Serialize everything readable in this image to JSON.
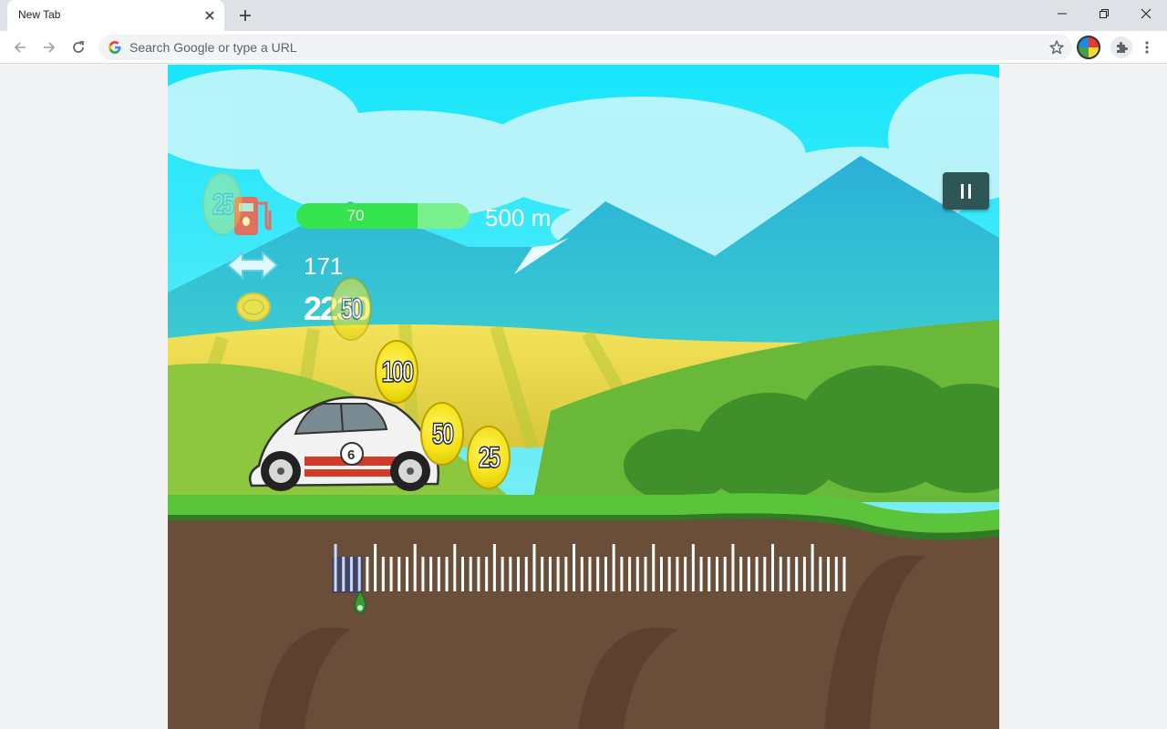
{
  "browser": {
    "tab_title": "New Tab",
    "omnibox_placeholder": "Search Google or type a URL"
  },
  "hud": {
    "fuel_value": "70",
    "fuel_fraction": 0.7,
    "distance_goal": "500 m",
    "distance_value": "171",
    "coins_value": "2230"
  },
  "coins": [
    {
      "value": "100"
    },
    {
      "value": "50"
    },
    {
      "value": "25"
    },
    {
      "value": "50"
    },
    {
      "value": "25"
    }
  ],
  "colors": {
    "sky_top": "#17e6fb",
    "ground": "#6b4e3a",
    "grass": "#5cc43a",
    "pause_button": "#2f5656"
  },
  "icons": {
    "fuel": "fuel-pump-icon",
    "distance": "double-arrow-icon",
    "coin": "coin-icon",
    "pause": "pause-icon"
  }
}
